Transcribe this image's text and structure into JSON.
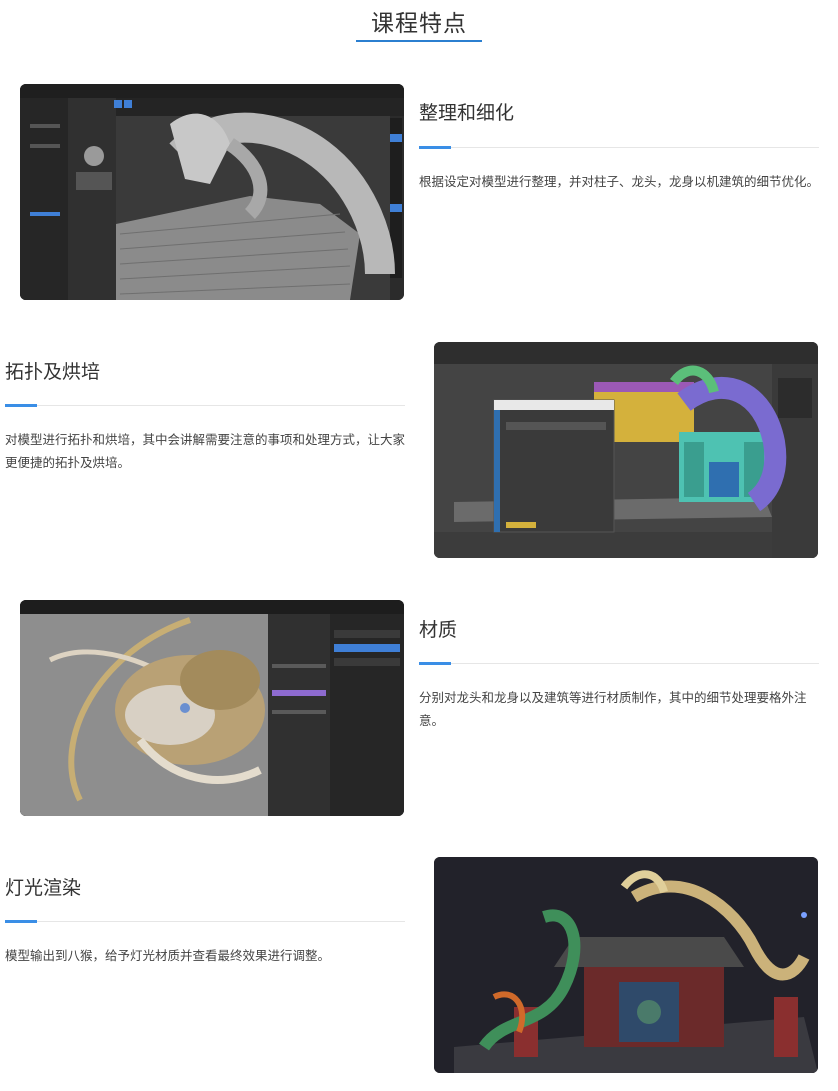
{
  "page": {
    "title": "课程特点",
    "accent_color": "#3a8ee6"
  },
  "sections": [
    {
      "title": "整理和细化",
      "description": "根据设定对模型进行整理，并对柱子、龙头，龙身以机建筑的细节优化。",
      "image": "zbrush-dragon-sculpt-screenshot"
    },
    {
      "title": "拓扑及烘培",
      "description": "对模型进行拓扑和烘培，其中会讲解需要注意的事项和处理方式，让大家更便捷的拓扑及烘培。",
      "image": "3dsmax-dragon-building-screenshot"
    },
    {
      "title": "材质",
      "description": "分别对龙头和龙身以及建筑等进行材质制作，其中的细节处理要格外注意。",
      "image": "substance-painter-dragon-head-screenshot"
    },
    {
      "title": "灯光渲染",
      "description": "模型输出到八猴，给予灯光材质并查看最终效果进行调整。",
      "image": "final-render-dragon-gate"
    }
  ]
}
